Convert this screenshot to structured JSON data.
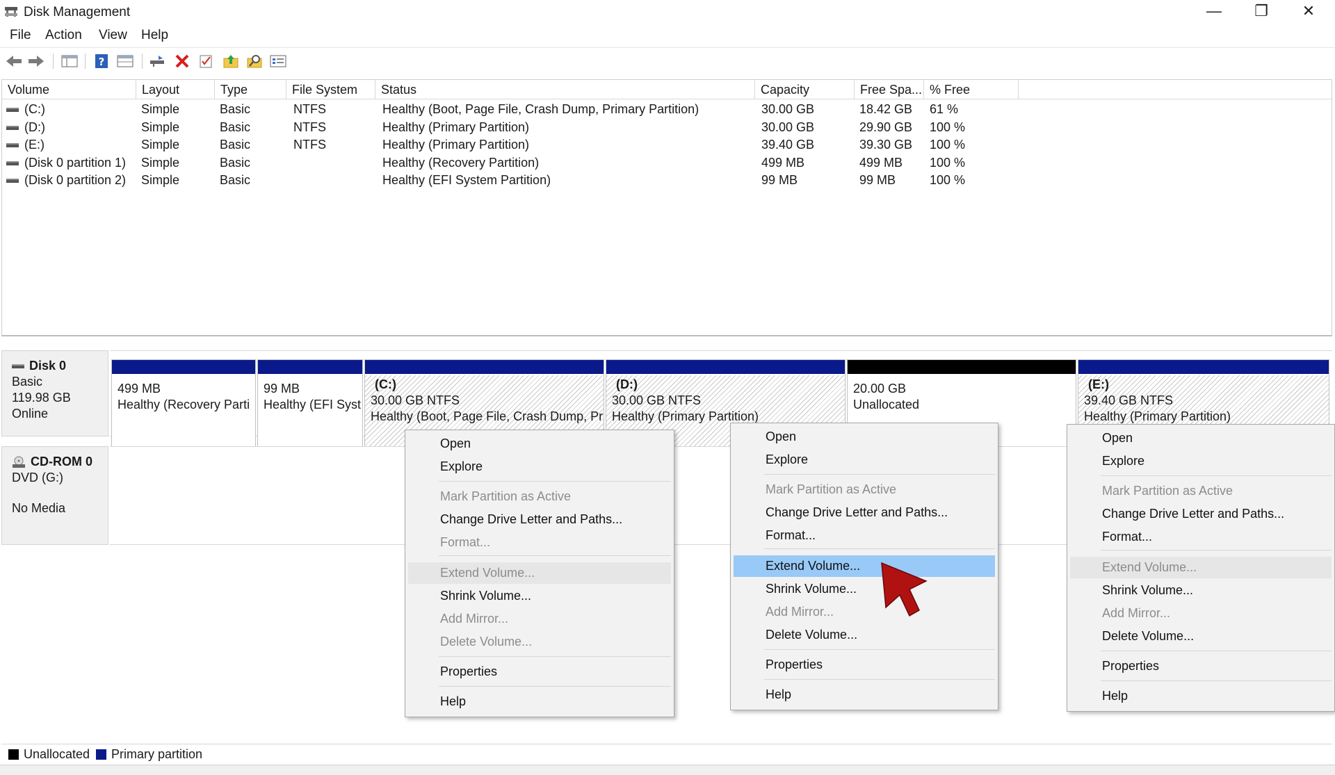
{
  "window": {
    "title": "Disk Management",
    "minimize": "—",
    "maximize": "❐",
    "close": "✕"
  },
  "menu": [
    "File",
    "Action",
    "View",
    "Help"
  ],
  "toolbar": {
    "icons": [
      "back-arrow-icon",
      "forward-arrow-icon",
      "console-tree-icon",
      "help-icon",
      "show-hide-icon",
      "connect-icon",
      "delete-icon",
      "properties-icon",
      "up-folder-icon",
      "search-icon",
      "settings-list-icon"
    ],
    "delete_color": "#d81e1e"
  },
  "volume_list": {
    "columns": [
      "Volume",
      "Layout",
      "Type",
      "File System",
      "Status",
      "Capacity",
      "Free Spa...",
      "% Free"
    ],
    "rows": [
      {
        "volume": "(C:)",
        "layout": "Simple",
        "type": "Basic",
        "fs": "NTFS",
        "status": "Healthy (Boot, Page File, Crash Dump, Primary Partition)",
        "capacity": "30.00 GB",
        "free": "18.42 GB",
        "pct": "61 %"
      },
      {
        "volume": "(D:)",
        "layout": "Simple",
        "type": "Basic",
        "fs": "NTFS",
        "status": "Healthy (Primary Partition)",
        "capacity": "30.00 GB",
        "free": "29.90 GB",
        "pct": "100 %"
      },
      {
        "volume": "(E:)",
        "layout": "Simple",
        "type": "Basic",
        "fs": "NTFS",
        "status": "Healthy (Primary Partition)",
        "capacity": "39.40 GB",
        "free": "39.30 GB",
        "pct": "100 %"
      },
      {
        "volume": "(Disk 0 partition 1)",
        "layout": "Simple",
        "type": "Basic",
        "fs": "",
        "status": "Healthy (Recovery Partition)",
        "capacity": "499 MB",
        "free": "499 MB",
        "pct": "100 %"
      },
      {
        "volume": "(Disk 0 partition 2)",
        "layout": "Simple",
        "type": "Basic",
        "fs": "",
        "status": "Healthy (EFI System Partition)",
        "capacity": "99 MB",
        "free": "99 MB",
        "pct": "100 %"
      }
    ]
  },
  "disk0": {
    "name": "Disk 0",
    "type": "Basic",
    "size": "119.98 GB",
    "status": "Online",
    "partitions": [
      {
        "title": "",
        "size": "499 MB",
        "status": "Healthy (Recovery Parti"
      },
      {
        "title": "",
        "size": "99 MB",
        "status": "Healthy (EFI Syst"
      },
      {
        "title": "(C:)",
        "size": "30.00 GB NTFS",
        "status": "Healthy (Boot, Page File, Crash Dump, Pr"
      },
      {
        "title": "(D:)",
        "size": "30.00 GB NTFS",
        "status": "Healthy (Primary Partition)"
      },
      {
        "title": "",
        "size": "20.00 GB",
        "status": "Unallocated"
      },
      {
        "title": "(E:)",
        "size": "39.40 GB NTFS",
        "status": "Healthy (Primary Partition)"
      }
    ]
  },
  "cdrom": {
    "name": "CD-ROM 0",
    "drive": "DVD (G:)",
    "status": "No Media"
  },
  "legend": {
    "unallocated": "Unallocated",
    "primary": "Primary partition",
    "unallocated_color": "#000000",
    "primary_color": "#0a1a8a"
  },
  "context_menus": [
    {
      "items": [
        {
          "label": "Open",
          "state": "enabled"
        },
        {
          "label": "Explore",
          "state": "enabled"
        },
        {
          "label": "Mark Partition as Active",
          "state": "disabled"
        },
        {
          "label": "Change Drive Letter and Paths...",
          "state": "enabled"
        },
        {
          "label": "Format...",
          "state": "disabled"
        },
        {
          "label": "Extend Volume...",
          "state": "disabled-hover"
        },
        {
          "label": "Shrink Volume...",
          "state": "enabled"
        },
        {
          "label": "Add Mirror...",
          "state": "disabled"
        },
        {
          "label": "Delete Volume...",
          "state": "disabled"
        },
        {
          "label": "Properties",
          "state": "enabled"
        },
        {
          "label": "Help",
          "state": "enabled"
        }
      ]
    },
    {
      "items": [
        {
          "label": "Open",
          "state": "enabled"
        },
        {
          "label": "Explore",
          "state": "enabled"
        },
        {
          "label": "Mark Partition as Active",
          "state": "disabled"
        },
        {
          "label": "Change Drive Letter and Paths...",
          "state": "enabled"
        },
        {
          "label": "Format...",
          "state": "enabled"
        },
        {
          "label": "Extend Volume...",
          "state": "highlighted"
        },
        {
          "label": "Shrink Volume...",
          "state": "enabled"
        },
        {
          "label": "Add Mirror...",
          "state": "disabled"
        },
        {
          "label": "Delete Volume...",
          "state": "enabled"
        },
        {
          "label": "Properties",
          "state": "enabled"
        },
        {
          "label": "Help",
          "state": "enabled"
        }
      ]
    },
    {
      "items": [
        {
          "label": "Open",
          "state": "enabled"
        },
        {
          "label": "Explore",
          "state": "enabled"
        },
        {
          "label": "Mark Partition as Active",
          "state": "disabled"
        },
        {
          "label": "Change Drive Letter and Paths...",
          "state": "enabled"
        },
        {
          "label": "Format...",
          "state": "enabled"
        },
        {
          "label": "Extend Volume...",
          "state": "disabled-hover"
        },
        {
          "label": "Shrink Volume...",
          "state": "enabled"
        },
        {
          "label": "Add Mirror...",
          "state": "disabled"
        },
        {
          "label": "Delete Volume...",
          "state": "enabled"
        },
        {
          "label": "Properties",
          "state": "enabled"
        },
        {
          "label": "Help",
          "state": "enabled"
        }
      ]
    }
  ],
  "highlight_color": "#99c9f7",
  "cursor_color": "#b01212"
}
